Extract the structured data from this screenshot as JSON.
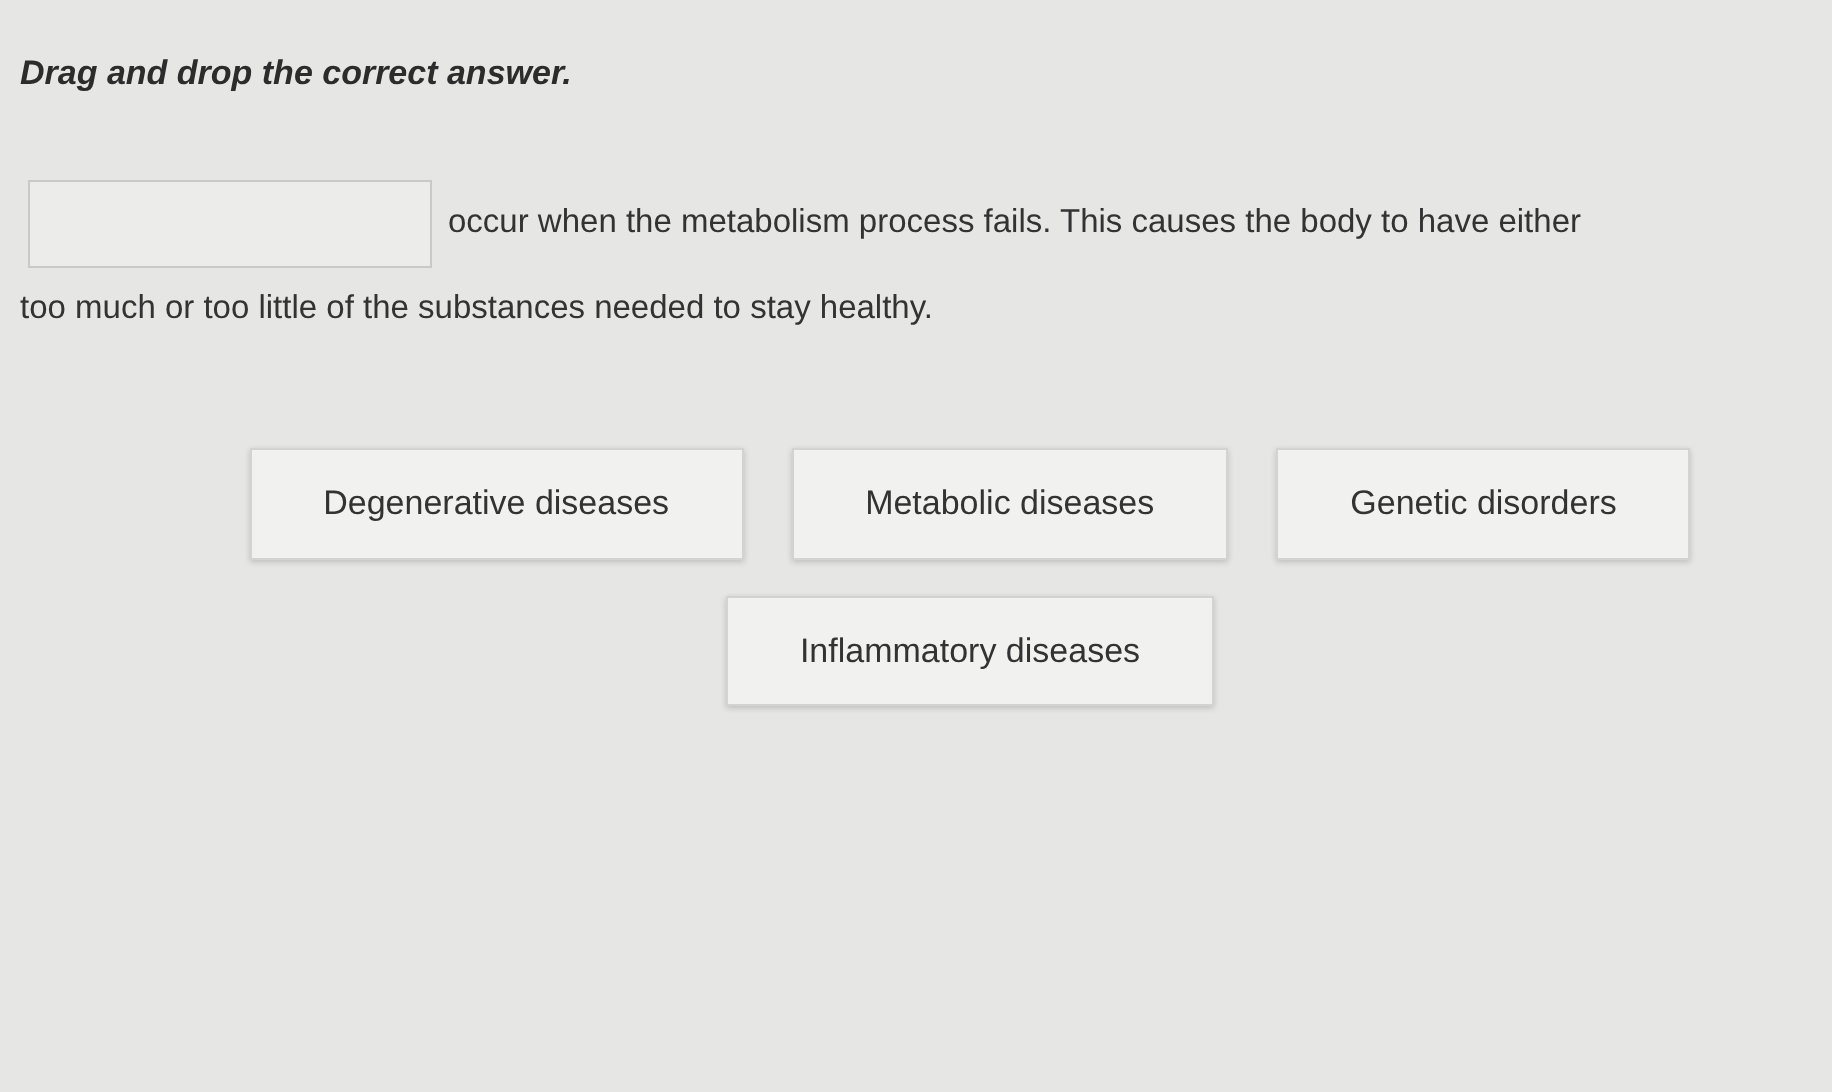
{
  "instruction": "Drag and drop the correct answer.",
  "sentence_lines": [
    "occur when the metabolism process fails. This causes the body to have either",
    "too much or too little of the substances needed to stay healthy."
  ],
  "answers": [
    {
      "label": "Degenerative diseases"
    },
    {
      "label": "Metabolic diseases"
    },
    {
      "label": "Genetic disorders"
    },
    {
      "label": "Inflammatory diseases"
    }
  ]
}
